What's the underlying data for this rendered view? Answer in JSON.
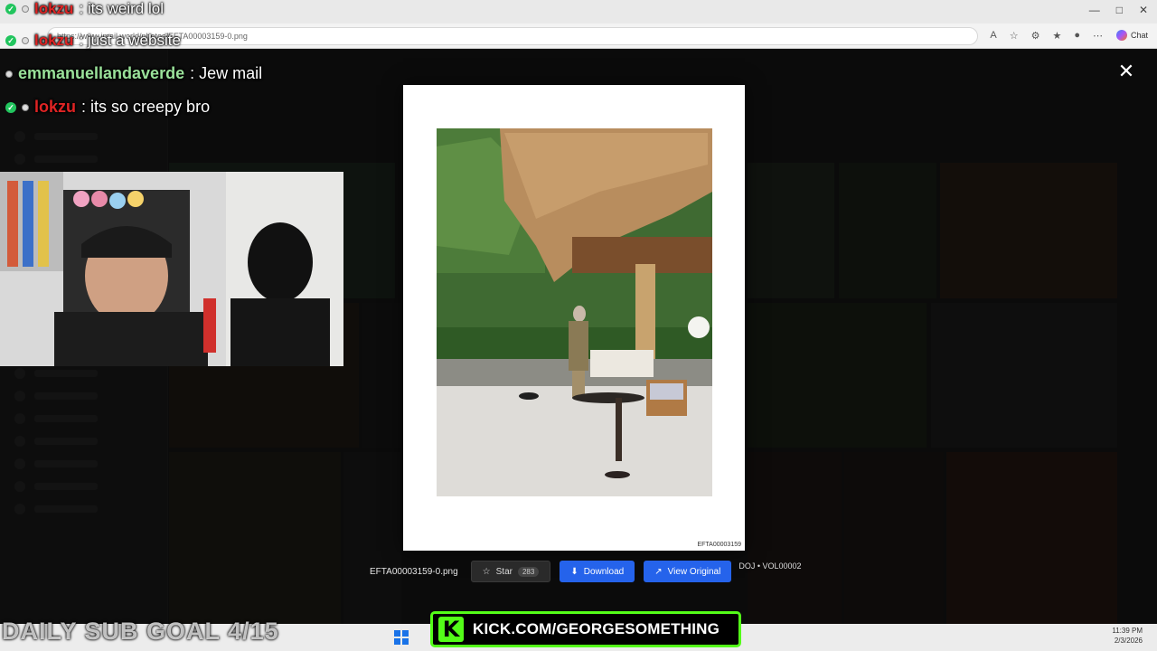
{
  "browser": {
    "address": "https://www.jmail.world/photos/EFTA00003159-0.png",
    "chat_label": "Chat"
  },
  "chat": [
    {
      "user": "lokzu",
      "message": ": its weird lol",
      "user_color": "#e02424"
    },
    {
      "user": "lokzu",
      "message": ": just a website",
      "user_color": "#e02424"
    },
    {
      "user": "emmanuellandaverde",
      "message": ": Jew mail",
      "user_color": "#9ae29a"
    },
    {
      "user": "lokzu",
      "message": ": its so creepy bro",
      "user_color": "#e02424"
    }
  ],
  "modal": {
    "file_id": "EFTA00003159",
    "filename": "EFTA00003159-0.png",
    "star_label": "Star",
    "star_count": "283",
    "download_label": "Download",
    "view_original_label": "View Original",
    "volume": "DOJ • VOL00002",
    "close_icon": "close-icon"
  },
  "overlay": {
    "sub_goal": "DAILY SUB GOAL 4/15",
    "kick_url": "KICK.COM/GEORGESOMETHING"
  },
  "taskbar": {
    "time": "11:39 PM",
    "date": "2/3/2026"
  },
  "colors": {
    "kick_green": "#53fc18",
    "primary_blue": "#2563eb"
  }
}
